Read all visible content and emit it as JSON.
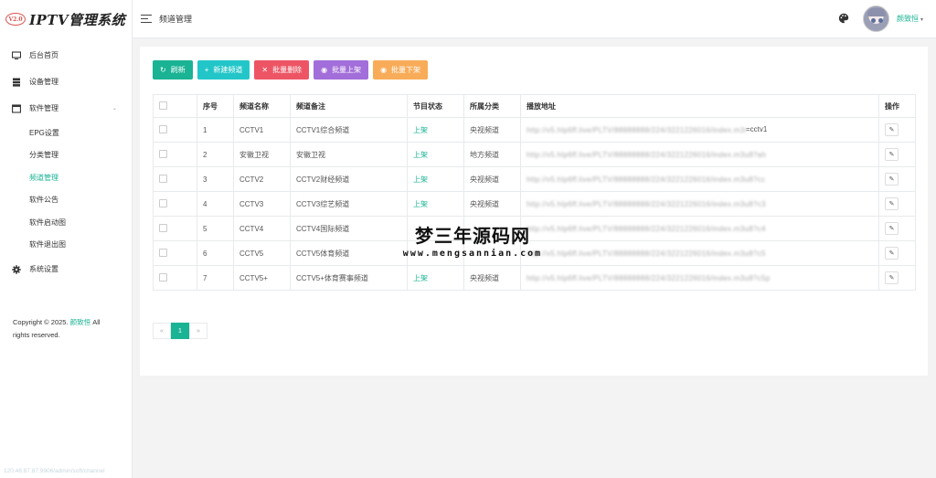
{
  "brand": {
    "badge": "V2.0",
    "title": "IPTV管理系统"
  },
  "sidebar": {
    "items": [
      {
        "label": "后台首页",
        "icon": "monitor-icon"
      },
      {
        "label": "设备管理",
        "icon": "server-icon"
      },
      {
        "label": "软件管理",
        "icon": "window-icon"
      }
    ],
    "submenu": [
      "EPG设置",
      "分类管理",
      "频道管理",
      "软件公告",
      "软件启动图",
      "软件退出图"
    ],
    "settings": {
      "label": "系统设置",
      "icon": "gear-icon"
    },
    "copyright_prefix": "Copyright © 2025.",
    "copyright_name": "颜致恒",
    "copyright_suffix": "All rights reserved."
  },
  "statusbar": "120.46.87.87:9906/admin/soft/channel",
  "header": {
    "title": "频道管理",
    "username": "颜致恒"
  },
  "toolbar": {
    "refresh": "刷新",
    "add": "新建频道",
    "batch_delete": "批量删除",
    "batch_up": "批量上架",
    "batch_down": "批量下架"
  },
  "table": {
    "columns": [
      "序号",
      "频道名称",
      "频道备注",
      "节目状态",
      "所属分类",
      "播放地址",
      "操作"
    ],
    "rows": [
      {
        "num": "1",
        "name": "CCTV1",
        "note": "CCTV1综合频道",
        "status": "上架",
        "category": "央视频道",
        "url": "http://v5.hlp6ff.live/PLTV/88888888/224/3221226016/index.m3u8",
        "url_tail": "=cctv1"
      },
      {
        "num": "2",
        "name": "安徽卫视",
        "note": "安徽卫视",
        "status": "上架",
        "category": "地方频道",
        "url": "http://v5.hlp6ff.live/PLTV/88888888/224/3221226016/index.m3u8?ah",
        "url_tail": ""
      },
      {
        "num": "3",
        "name": "CCTV2",
        "note": "CCTV2财经频道",
        "status": "上架",
        "category": "央视频道",
        "url": "http://v5.hlp6ff.live/PLTV/88888888/224/3221226016/index.m3u8?cc",
        "url_tail": ""
      },
      {
        "num": "4",
        "name": "CCTV3",
        "note": "CCTV3综艺频道",
        "status": "上架",
        "category": "央视频道",
        "url": "http://v5.hlp6ff.live/PLTV/88888888/224/3221226016/index.m3u8?c3",
        "url_tail": ""
      },
      {
        "num": "5",
        "name": "CCTV4",
        "note": "CCTV4国际频道",
        "status": "",
        "category": "",
        "url": "http://v5.hlp6ff.live/PLTV/88888888/224/3221226016/index.m3u8?c4",
        "url_tail": ""
      },
      {
        "num": "6",
        "name": "CCTV5",
        "note": "CCTV5体育频道",
        "status": "",
        "category": "",
        "url": "http://v5.hlp6ff.live/PLTV/88888888/224/3221226016/index.m3u8?c5",
        "url_tail": ""
      },
      {
        "num": "7",
        "name": "CCTV5+",
        "note": "CCTV5+体育赛事频道",
        "status": "上架",
        "category": "央视频道",
        "url": "http://v5.hlp6ff.live/PLTV/88888888/224/3221226016/index.m3u8?c5p",
        "url_tail": ""
      }
    ]
  },
  "pagination": {
    "prev": "«",
    "current": "1",
    "next": "»"
  },
  "watermark": {
    "cn": "梦三年源码网",
    "en": "www.mengsannian.com"
  },
  "colors": {
    "accent": "#1ab394",
    "cyan": "#23c6c8",
    "red": "#ed5565",
    "purple": "#a26ed9",
    "orange": "#f8ac59"
  }
}
